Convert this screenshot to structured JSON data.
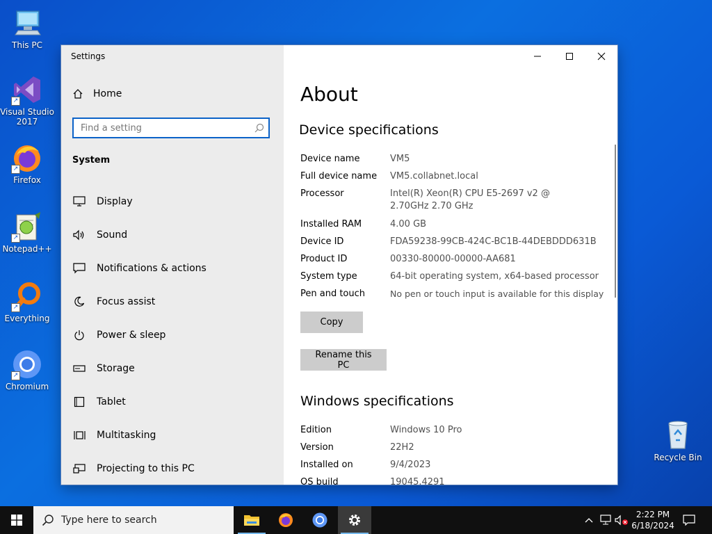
{
  "desktop": {
    "icons": [
      {
        "label": "This PC"
      },
      {
        "label": "Visual Studio 2017"
      },
      {
        "label": "Firefox"
      },
      {
        "label": "Notepad++"
      },
      {
        "label": "Everything"
      },
      {
        "label": "Chromium"
      },
      {
        "label": "Recycle Bin"
      }
    ]
  },
  "window": {
    "title": "Settings",
    "sidebar": {
      "home_label": "Home",
      "search_placeholder": "Find a setting",
      "section_label": "System",
      "items": [
        {
          "label": "Display",
          "icon": "monitor-icon"
        },
        {
          "label": "Sound",
          "icon": "speaker-icon"
        },
        {
          "label": "Notifications & actions",
          "icon": "notification-icon"
        },
        {
          "label": "Focus assist",
          "icon": "moon-icon"
        },
        {
          "label": "Power & sleep",
          "icon": "power-icon"
        },
        {
          "label": "Storage",
          "icon": "storage-icon"
        },
        {
          "label": "Tablet",
          "icon": "tablet-icon"
        },
        {
          "label": "Multitasking",
          "icon": "multitasking-icon"
        },
        {
          "label": "Projecting to this PC",
          "icon": "projector-icon"
        }
      ]
    },
    "content": {
      "heading": "About",
      "device_specs_heading": "Device specifications",
      "device_specs": [
        {
          "label": "Device name",
          "value": "VM5"
        },
        {
          "label": "Full device name",
          "value": "VM5.collabnet.local"
        },
        {
          "label": "Processor",
          "value": "Intel(R) Xeon(R) CPU E5-2697 v2 @ 2.70GHz   2.70 GHz"
        },
        {
          "label": "Installed RAM",
          "value": "4.00 GB"
        },
        {
          "label": "Device ID",
          "value": "FDA59238-99CB-424C-BC1B-44DEBDDD631B"
        },
        {
          "label": "Product ID",
          "value": "00330-80000-00000-AA681"
        },
        {
          "label": "System type",
          "value": "64-bit operating system, x64-based processor"
        },
        {
          "label": "Pen and touch",
          "value": "No pen or touch input is available for this display"
        }
      ],
      "copy_button": "Copy",
      "rename_button": "Rename this PC",
      "windows_specs_heading": "Windows specifications",
      "windows_specs": [
        {
          "label": "Edition",
          "value": "Windows 10 Pro"
        },
        {
          "label": "Version",
          "value": "22H2"
        },
        {
          "label": "Installed on",
          "value": "9/4/2023"
        },
        {
          "label": "OS build",
          "value": "19045.4291"
        }
      ]
    }
  },
  "taskbar": {
    "search_placeholder": "Type here to search",
    "time": "2:22 PM",
    "date": "6/18/2024"
  },
  "colors": {
    "accent": "#0b62c8",
    "sidebar_bg": "#ececec",
    "button_bg": "#cccccc",
    "taskbar_bg": "#101010"
  }
}
